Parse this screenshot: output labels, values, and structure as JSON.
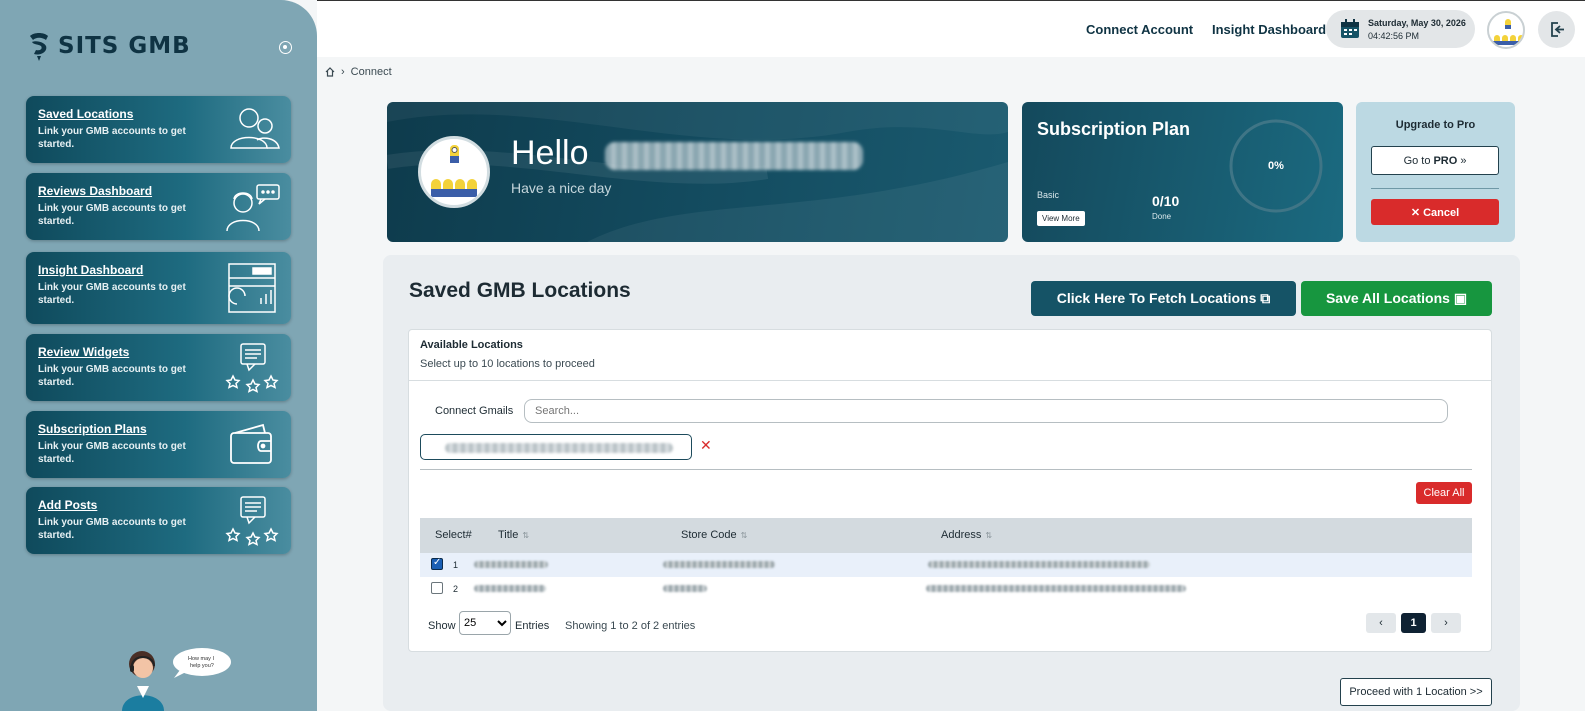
{
  "brand": {
    "name": "SITS GMB"
  },
  "sidebar": {
    "items": [
      {
        "title": "Saved Locations",
        "desc": "Link your GMB accounts to get started.",
        "icon": "users-icon"
      },
      {
        "title": "Reviews Dashboard",
        "desc": "Link your GMB accounts to get started.",
        "icon": "chat-user-icon"
      },
      {
        "title": "Insight Dashboard",
        "desc": "Link your GMB accounts to get started.",
        "icon": "dashboard-icon"
      },
      {
        "title": "Review Widgets",
        "desc": "Link your GMB accounts to get started.",
        "icon": "review-stars-icon"
      },
      {
        "title": "Subscription Plans",
        "desc": "Link your GMB accounts to get started.",
        "icon": "wallet-icon"
      },
      {
        "title": "Add Posts",
        "desc": "Link your GMB accounts to get started.",
        "icon": "post-stars-icon"
      }
    ],
    "assistant_bubble": "How may I help you?"
  },
  "header": {
    "nav": [
      "Connect Account",
      "Insight Dashboard"
    ],
    "date": "Saturday, May 30, 2026",
    "time": "04:42:56 PM"
  },
  "breadcrumb": {
    "current": "Connect"
  },
  "hero": {
    "greeting": "Hello",
    "subtext": "Have a nice day"
  },
  "subscription": {
    "title": "Subscription Plan",
    "plan": "Basic",
    "view_more": "View More",
    "count": "0/10",
    "count_label": "Done",
    "percent_label": "0%",
    "percent": 0
  },
  "upgrade": {
    "title": "Upgrade to Pro",
    "goto_prefix": "Go to",
    "goto_bold": "PRO",
    "cancel": "✕ Cancel"
  },
  "main": {
    "title": "Saved GMB Locations",
    "fetch_label": "Click Here To Fetch Locations",
    "save_label": "Save All Locations",
    "available_title": "Available Locations",
    "available_sub": "Select up to 10 locations to proceed",
    "connect_gmails": "Connect Gmails",
    "search_placeholder": "Search...",
    "clear_all": "Clear All",
    "columns": [
      "Select#",
      "Title",
      "Store Code",
      "Address"
    ],
    "rows": [
      {
        "num": "1",
        "selected": true
      },
      {
        "num": "2",
        "selected": false
      }
    ],
    "show_label": "Show",
    "entries_value": "25",
    "entries_label": "Entries",
    "showing": "Showing 1 to 2 of 2 entries",
    "page_prev": "‹",
    "page_current": "1",
    "page_next": "›",
    "proceed": "Proceed with 1 Location >>"
  },
  "colors": {
    "sidebar_bg": "#7fa6b4",
    "brand_dark": "#0f3343",
    "fetch_btn": "#155366",
    "save_btn": "#17963f",
    "danger": "#d92b2b"
  }
}
